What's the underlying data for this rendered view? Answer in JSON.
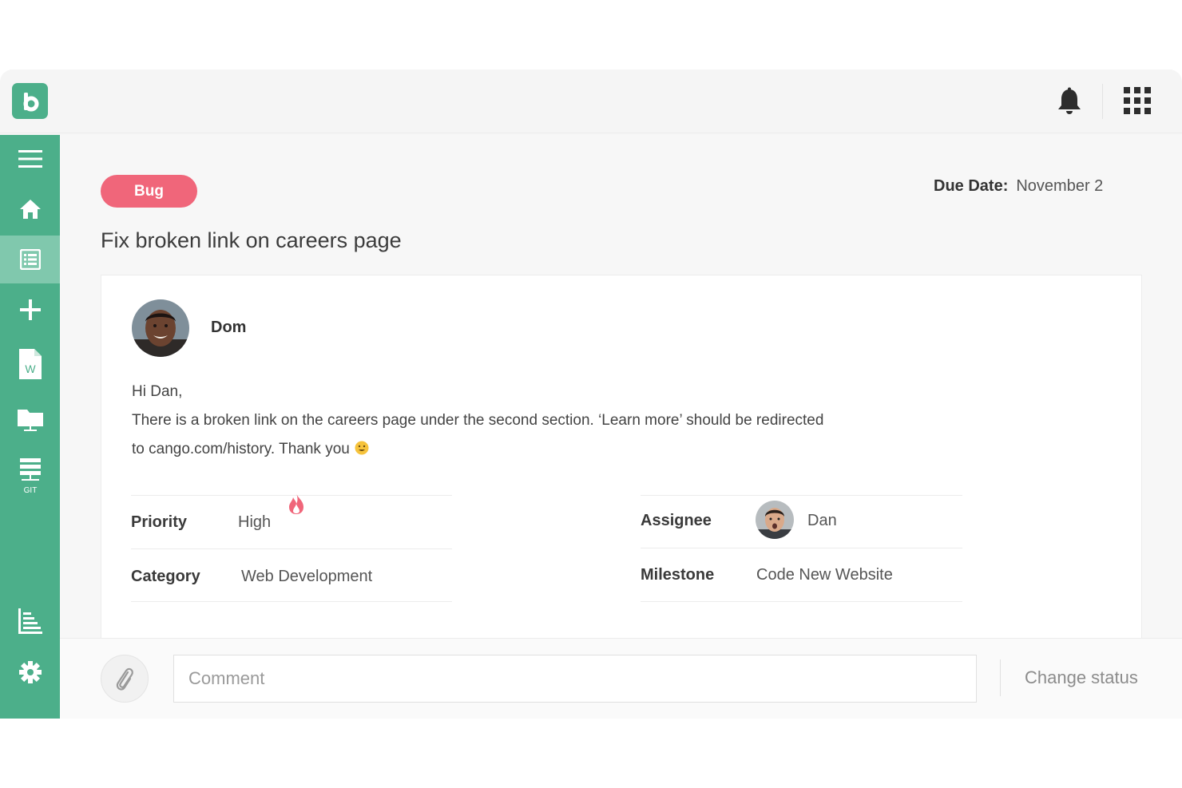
{
  "colors": {
    "brand": "#4caf8a",
    "sidebar_active": "#80c8ad",
    "tag": "#f0667a",
    "priority_flame": "#f0667a"
  },
  "topbar": {
    "logo_letter": "b",
    "icons": [
      "bell-icon",
      "apps-grid-icon"
    ]
  },
  "sidebar": {
    "items": [
      {
        "icon": "menu-icon"
      },
      {
        "icon": "home-icon"
      },
      {
        "icon": "task-list-icon",
        "active": true
      },
      {
        "icon": "add-icon"
      },
      {
        "icon": "word-document-icon",
        "label": "W"
      },
      {
        "icon": "folder-icon"
      },
      {
        "icon": "git-icon",
        "label": "GIT"
      },
      {
        "icon": "bar-chart-icon"
      },
      {
        "icon": "settings-icon"
      }
    ]
  },
  "task": {
    "tag": "Bug",
    "due_label": "Due Date:",
    "due_value": "November 2",
    "title": "Fix broken link on careers page"
  },
  "post": {
    "author": "Dom",
    "message_lines": [
      "Hi Dan,",
      "There is a broken link on the careers page under the second section. ‘Learn more’ should be redirected",
      "to cango.com/history. Thank you"
    ]
  },
  "fields": {
    "priority_label": "Priority",
    "priority_value": "High",
    "category_label": "Category",
    "category_value": "Web Development",
    "assignee_label": "Assignee",
    "assignee_value": "Dan",
    "milestone_label": "Milestone",
    "milestone_value": "Code New Website"
  },
  "footer": {
    "comment_placeholder": "Comment",
    "change_status_label": "Change status"
  }
}
